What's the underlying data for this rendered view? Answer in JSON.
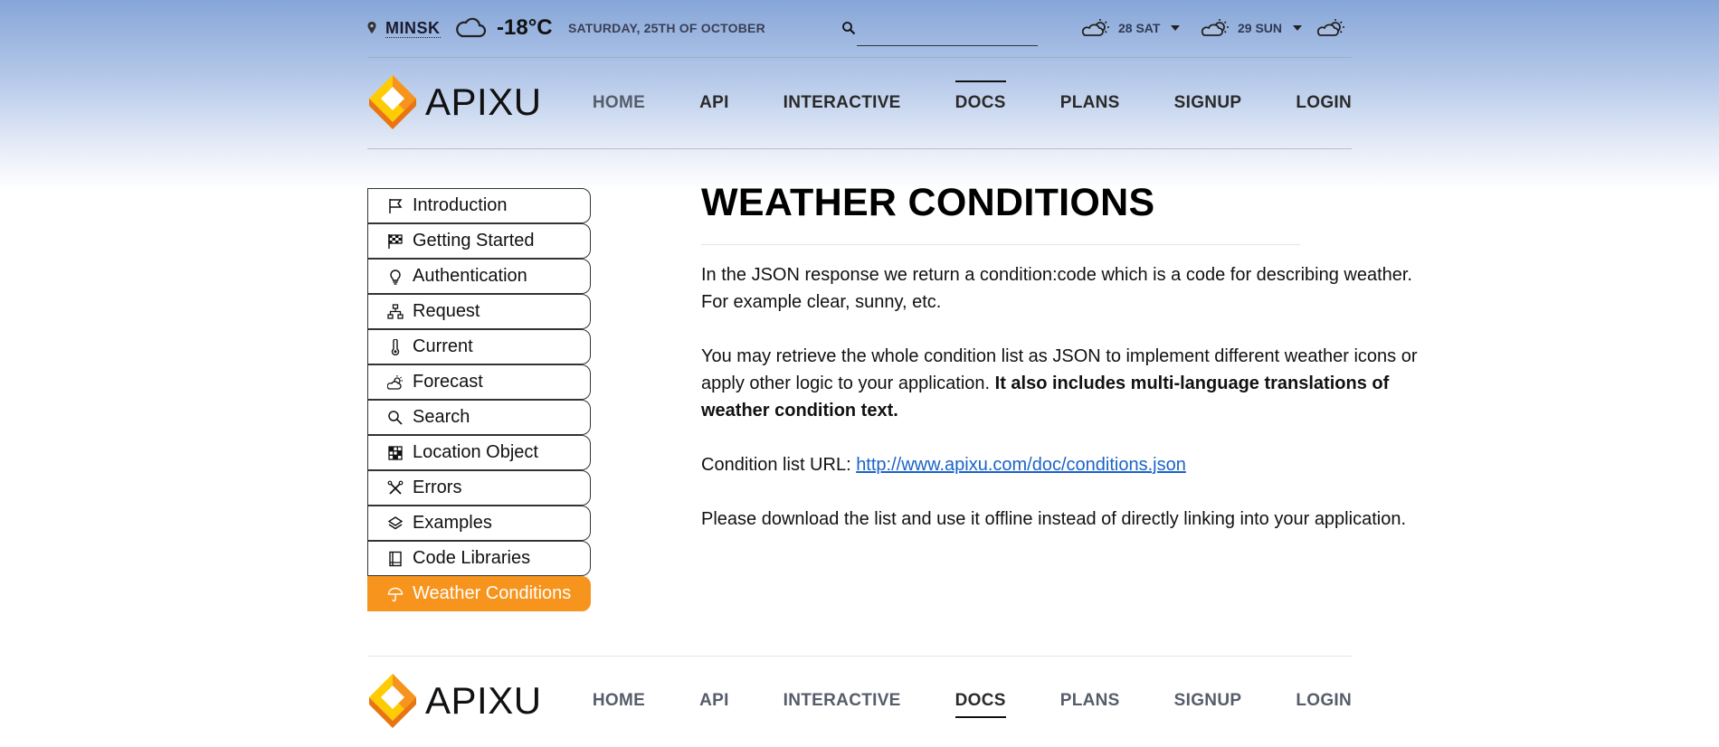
{
  "topbar": {
    "city": "MINSK",
    "temperature": "-18°C",
    "date": "SATURDAY, 25TH OF OCTOBER",
    "search_placeholder": "",
    "forecast": [
      {
        "label": "28 SAT",
        "icon": "partly-sunny-icon"
      },
      {
        "label": "29 SUN",
        "icon": "partly-sunny-icon"
      },
      {
        "label": "",
        "icon": "partly-sunny-icon"
      }
    ]
  },
  "brand": {
    "name": "APIXU",
    "colors": {
      "orange": "#f7941d",
      "yellow": "#ffcb05",
      "dark_orange": "#e87511"
    }
  },
  "nav": [
    "HOME",
    "API",
    "INTERACTIVE",
    "DOCS",
    "PLANS",
    "SIGNUP",
    "LOGIN"
  ],
  "nav_active": "DOCS",
  "sidebar": [
    {
      "label": "Introduction",
      "icon": "flag-icon"
    },
    {
      "label": "Getting Started",
      "icon": "checkered-flag-icon"
    },
    {
      "label": "Authentication",
      "icon": "lightbulb-icon"
    },
    {
      "label": "Request",
      "icon": "sitemap-icon"
    },
    {
      "label": "Current",
      "icon": "thermometer-icon"
    },
    {
      "label": "Forecast",
      "icon": "cloud-sun-icon"
    },
    {
      "label": "Search",
      "icon": "search-icon"
    },
    {
      "label": "Location Object",
      "icon": "grid-icon"
    },
    {
      "label": "Errors",
      "icon": "tools-icon"
    },
    {
      "label": "Examples",
      "icon": "layers-icon"
    },
    {
      "label": "Code Libraries",
      "icon": "book-icon"
    },
    {
      "label": "Weather Conditions",
      "icon": "umbrella-icon",
      "active": true
    }
  ],
  "content": {
    "title": "WEATHER CONDITIONS",
    "p1": "In the JSON response we return a condition:code which is a code for describing weather. For example clear, sunny, etc.",
    "p2_plain": "You may retrieve the whole condition list as JSON to implement different weather icons or apply other logic to your application. ",
    "p2_bold": "It also includes multi-language translations of weather condition text.",
    "p3_label": "Condition list URL: ",
    "p3_link": "http://www.apixu.com/doc/conditions.json",
    "p4": "Please download the list and use it offline instead of directly linking into your application."
  },
  "accent_color": "#f7941d",
  "link_color": "#1a63c9"
}
